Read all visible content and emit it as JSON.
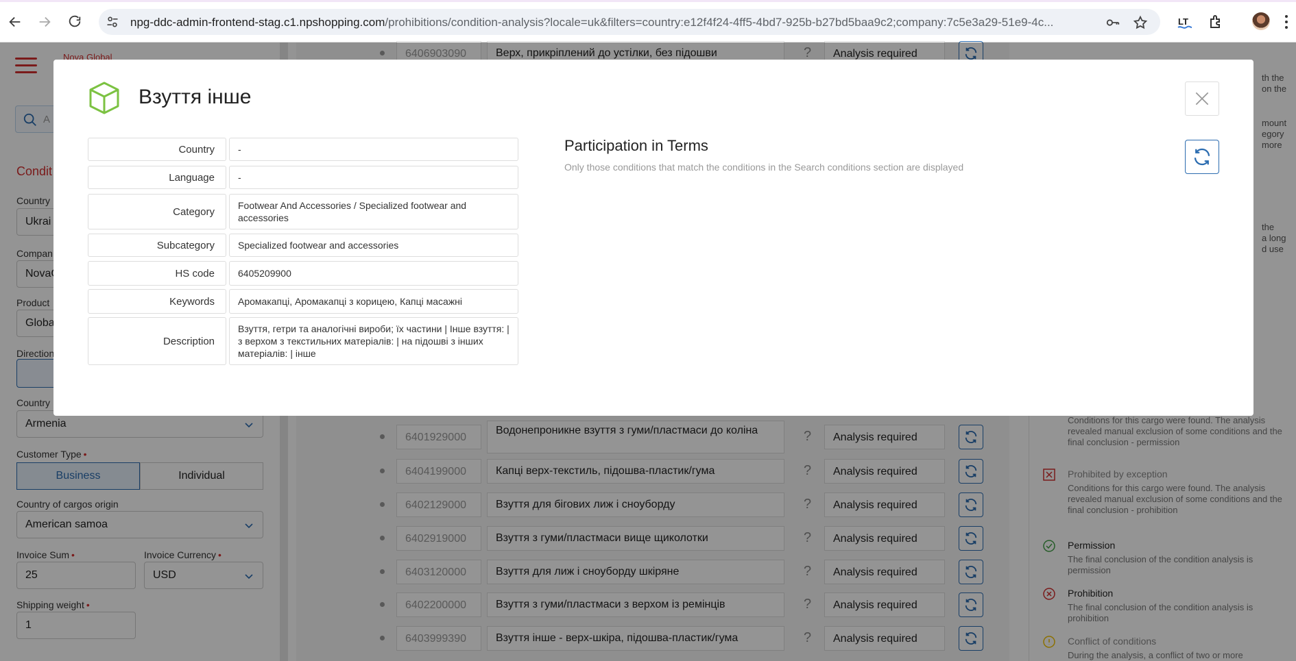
{
  "browser": {
    "url_host": "npg-ddc-admin-frontend-stag.c1.npshopping.com",
    "url_path": "/prohibitions/condition-analysis?locale=uk&filters=country:e12f4f24-4ff5-4bd7-925b-b27bd5baa9c2;company:7c5e3a29-51e9-4c..."
  },
  "app": {
    "brand": "Nova Global",
    "search_placeholder": "A",
    "conditions_title": "Condit",
    "labels": {
      "country": "Country",
      "company": "Compan",
      "product": "Product",
      "direction": "Direction",
      "country2": "Country",
      "customer_type": "Customer Type",
      "origin": "Country of cargos origin",
      "invoice_sum": "Invoice Sum",
      "invoice_currency": "Invoice Currency",
      "shipping_weight": "Shipping weight"
    },
    "values": {
      "country": "Ukrai",
      "company": "NovaG",
      "product": "Globa",
      "country2": "Armenia",
      "origin": "American samoa",
      "invoice_sum": "25",
      "invoice_currency": "USD",
      "shipping_weight": "1"
    },
    "customer_types": [
      "Business",
      "Individual"
    ],
    "rows": [
      {
        "code": "6406903090",
        "name": "Верх, прикріплений до устілки, без підошви",
        "status": "Analysis required"
      },
      {
        "code": "6401929000",
        "name": "Водонепроникне взуття з гуми/пластмаси до коліна",
        "status": "Analysis required"
      },
      {
        "code": "6404199000",
        "name": "Капці верх-текстиль, підошва-пластик/гума",
        "status": "Analysis required"
      },
      {
        "code": "6402129000",
        "name": "Взуття для бігових лиж і сноуборду",
        "status": "Analysis required"
      },
      {
        "code": "6402919000",
        "name": "Взуття з гуми/пластмаси вище щиколотки",
        "status": "Analysis required"
      },
      {
        "code": "6403120000",
        "name": "Взуття для лиж і сноуборду шкіряне",
        "status": "Analysis required"
      },
      {
        "code": "6402200000",
        "name": "Взуття з гуми/пластмаси з верхом із ремінців",
        "status": "Analysis required"
      },
      {
        "code": "6403999390",
        "name": "Взуття інше - верх-шкіра, підошва-пластик/гума",
        "status": "Analysis required"
      }
    ],
    "side_fragments": [
      "th the",
      "on the",
      "mount",
      "egory",
      "more",
      "the",
      "a long",
      "d use"
    ],
    "legend": [
      {
        "title": "",
        "desc": "Conditions for this cargo were found. The analysis revealed manual exclusion of some conditions and the final conclusion - permission"
      },
      {
        "title": "Prohibited by exception",
        "desc": "Conditions for this cargo were found. The analysis revealed manual exclusion of some conditions and the final conclusion - prohibition"
      },
      {
        "title": "Permission",
        "desc": "The final conclusion of the condition analysis is permission"
      },
      {
        "title": "Prohibition",
        "desc": "The final conclusion of the condition analysis is prohibition"
      },
      {
        "title": "Conflict of conditions",
        "desc": "During the analysis, a conflict of two or more"
      }
    ]
  },
  "modal": {
    "title": "Взуття інше",
    "fields": [
      {
        "label": "Country",
        "value": "-"
      },
      {
        "label": "Language",
        "value": "-"
      },
      {
        "label": "Category",
        "value": "Footwear And Accessories / Specialized footwear and accessories"
      },
      {
        "label": "Subcategory",
        "value": "Specialized footwear and accessories"
      },
      {
        "label": "HS code",
        "value": "6405209900"
      },
      {
        "label": "Keywords",
        "value": "Аромакапці, Аромакапці з корицею, Капці масажні"
      },
      {
        "label": "Description",
        "value": "Взуття, гетри та аналогічні вироби; їх частини | Інше взуття: | з верхом з текстильних матеріалів: | на підошві з інших матеріалів: | інше"
      }
    ],
    "participation": {
      "title": "Participation in Terms",
      "subtitle": "Only those conditions that match the conditions in the Search conditions section are displayed"
    }
  }
}
